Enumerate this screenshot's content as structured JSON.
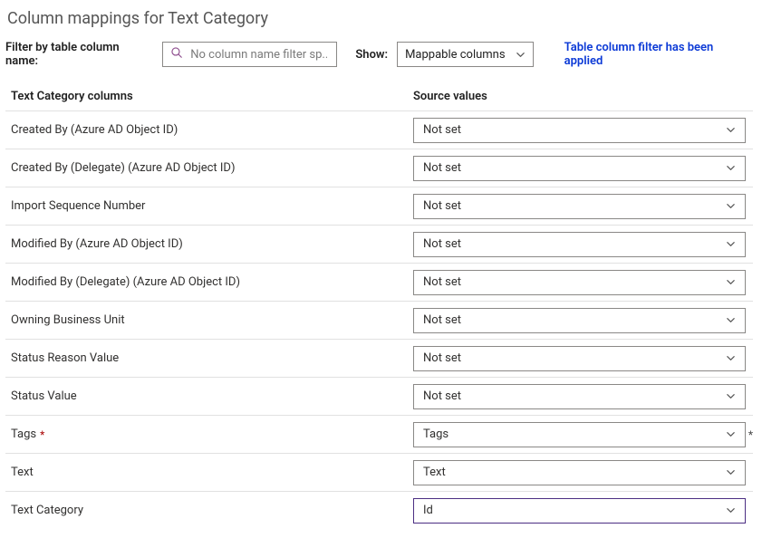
{
  "title": "Column mappings for Text Category",
  "filter": {
    "label": "Filter by table column name:",
    "placeholder": "No column name filter sp..."
  },
  "show": {
    "label": "Show:",
    "value": "Mappable columns"
  },
  "status_message": "Table column filter has been applied",
  "headers": {
    "columns": "Text Category columns",
    "source": "Source values"
  },
  "rows": [
    {
      "label": "Created By (Azure AD Object ID)",
      "required": false,
      "value": "Not set",
      "active": false,
      "row_marker": false
    },
    {
      "label": "Created By (Delegate) (Azure AD Object ID)",
      "required": false,
      "value": "Not set",
      "active": false,
      "row_marker": false
    },
    {
      "label": "Import Sequence Number",
      "required": false,
      "value": "Not set",
      "active": false,
      "row_marker": false
    },
    {
      "label": "Modified By (Azure AD Object ID)",
      "required": false,
      "value": "Not set",
      "active": false,
      "row_marker": false
    },
    {
      "label": "Modified By (Delegate) (Azure AD Object ID)",
      "required": false,
      "value": "Not set",
      "active": false,
      "row_marker": false
    },
    {
      "label": "Owning Business Unit",
      "required": false,
      "value": "Not set",
      "active": false,
      "row_marker": false
    },
    {
      "label": "Status Reason Value",
      "required": false,
      "value": "Not set",
      "active": false,
      "row_marker": false
    },
    {
      "label": "Status Value",
      "required": false,
      "value": "Not set",
      "active": false,
      "row_marker": false
    },
    {
      "label": "Tags",
      "required": true,
      "value": "Tags",
      "active": false,
      "row_marker": true
    },
    {
      "label": "Text",
      "required": false,
      "value": "Text",
      "active": false,
      "row_marker": false
    },
    {
      "label": "Text Category",
      "required": false,
      "value": "Id",
      "active": true,
      "row_marker": false
    }
  ]
}
